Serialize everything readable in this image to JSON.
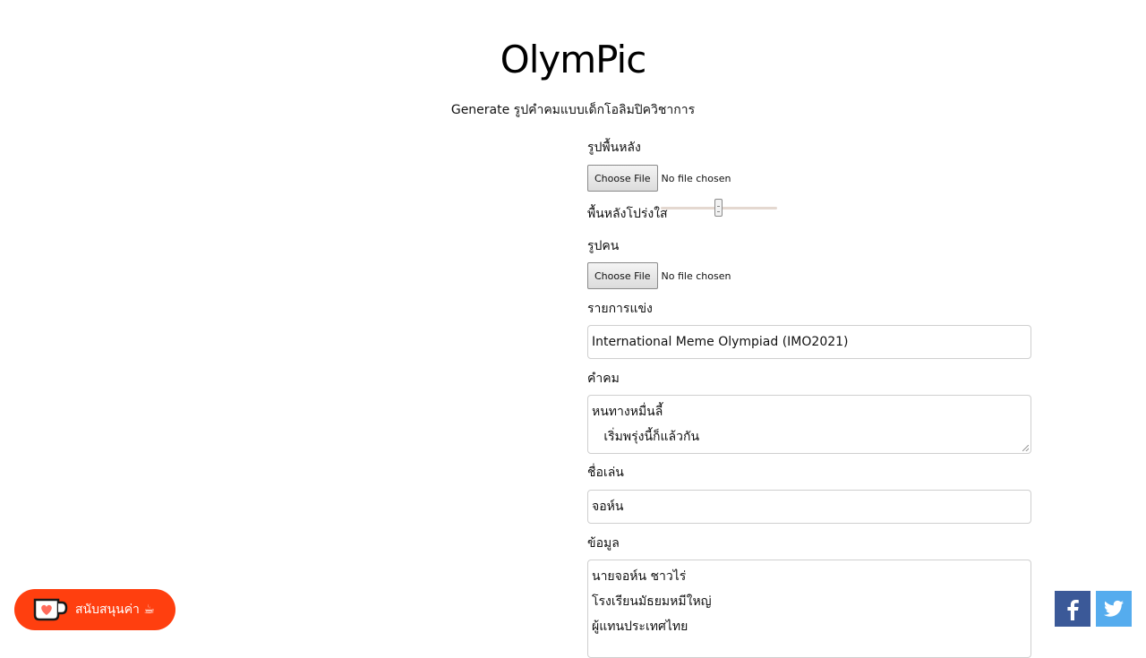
{
  "header": {
    "title": "OlymPic",
    "subtitle": "Generate รูปคำคมแบบเด็กโอลิมปิควิชาการ"
  },
  "form": {
    "background_label": "รูปพื้นหลัง",
    "background_file_button": "Choose File",
    "background_file_status": "No file chosen",
    "opacity_label": "พื้นหลังโปร่งใส",
    "opacity_value": 0.5,
    "person_label": "รูปคน",
    "person_file_button": "Choose File",
    "person_file_status": "No file chosen",
    "competition_label": "รายการแข่ง",
    "competition_value": "International Meme Olympiad (IMO2021)",
    "quote_label": "คำคม",
    "quote_lines": [
      "หนทางหมื่นลี้",
      "   เริ่มพรุ่งนี้ก็แล้วกัน"
    ],
    "nickname_label": "ชื่อเล่น",
    "nickname_value": "จอห์น",
    "info_label": "ข้อมูล",
    "info_lines": [
      "นายจอห์น ชาวไร่",
      "โรงเรียนมัธยมหมีใหญ่",
      "ผู้แทนประเทศไทย"
    ]
  },
  "support": {
    "label": "สนับสนุนค่า ☕"
  },
  "share": {
    "facebook": "f",
    "twitter": "twitter"
  },
  "colors": {
    "support_bg": "#ff3f0f",
    "facebook": "#3b5998",
    "twitter": "#55acee"
  }
}
